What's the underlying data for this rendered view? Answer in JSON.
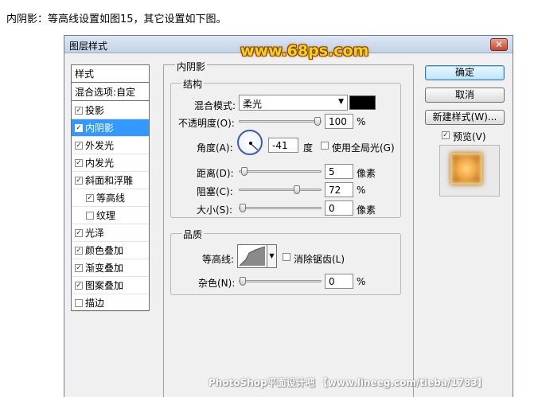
{
  "intro_text": "内阴影：等高线设置如图15，其它设置如下图。",
  "dialog": {
    "title": "图层样式",
    "close_symbol": "✕"
  },
  "watermark": "www.68ps.com",
  "left_panel": {
    "header": "样式",
    "blend_options": "混合选项:自定",
    "items": [
      {
        "label": "投影",
        "checked": true,
        "selected": false,
        "indent": false
      },
      {
        "label": "内阴影",
        "checked": true,
        "selected": true,
        "indent": false
      },
      {
        "label": "外发光",
        "checked": true,
        "selected": false,
        "indent": false
      },
      {
        "label": "内发光",
        "checked": true,
        "selected": false,
        "indent": false
      },
      {
        "label": "斜面和浮雕",
        "checked": true,
        "selected": false,
        "indent": false
      },
      {
        "label": "等高线",
        "checked": true,
        "selected": false,
        "indent": true
      },
      {
        "label": "纹理",
        "checked": false,
        "selected": false,
        "indent": true
      },
      {
        "label": "光泽",
        "checked": true,
        "selected": false,
        "indent": false
      },
      {
        "label": "颜色叠加",
        "checked": true,
        "selected": false,
        "indent": false
      },
      {
        "label": "渐变叠加",
        "checked": true,
        "selected": false,
        "indent": false
      },
      {
        "label": "图案叠加",
        "checked": true,
        "selected": false,
        "indent": false
      },
      {
        "label": "描边",
        "checked": false,
        "selected": false,
        "indent": false
      }
    ]
  },
  "inner_shadow": {
    "section_title": "内阴影",
    "structure": {
      "title": "结构",
      "blend_mode_label": "混合模式:",
      "blend_mode_value": "柔光",
      "color": "#000000",
      "opacity_label": "不透明度(O):",
      "opacity_value": "100",
      "opacity_fraction": 1.0,
      "opacity_unit": "%",
      "angle_label": "角度(A):",
      "angle_value": "-41",
      "angle_unit": "度",
      "global_light_label": "使用全局光(G)",
      "global_light_checked": false,
      "distance_label": "距离(D):",
      "distance_value": "5",
      "distance_fraction": 0.02,
      "distance_unit": "像素",
      "choke_label": "阻塞(C):",
      "choke_value": "72",
      "choke_fraction": 0.72,
      "choke_unit": "%",
      "size_label": "大小(S):",
      "size_value": "0",
      "size_fraction": 0.0,
      "size_unit": "像素"
    },
    "quality": {
      "title": "品质",
      "contour_label": "等高线:",
      "antialias_label": "消除锯齿(L)",
      "antialias_checked": false,
      "noise_label": "杂色(N):",
      "noise_value": "0",
      "noise_fraction": 0.0,
      "noise_unit": "%"
    }
  },
  "buttons": {
    "ok": "确定",
    "cancel": "取消",
    "new_style": "新建样式(W)...",
    "preview_label": "预览(V)",
    "preview_checked": true
  },
  "footer_watermark": "PhotoShop平面设计吧 【www.lineeg.com/tieba/1783】"
}
